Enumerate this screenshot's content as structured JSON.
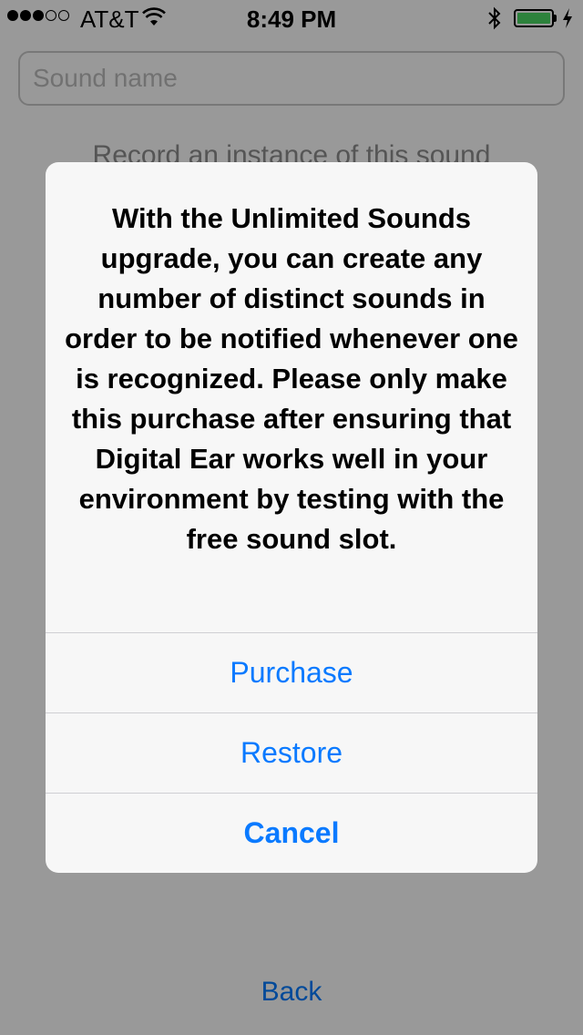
{
  "status_bar": {
    "carrier": "AT&T",
    "time": "8:49 PM",
    "signal_bars_filled": 3,
    "signal_bars_total": 5,
    "battery_color": "#4cd964"
  },
  "form": {
    "sound_name_placeholder": "Sound name",
    "instruction": "Record an instance of this sound",
    "back_label": "Back"
  },
  "alert": {
    "message": "With the Unlimited Sounds upgrade, you can create any number of distinct sounds in order to be notified whenever one is recognized. Please only make this purchase after ensuring that Digital Ear works well in your environment by testing with the free sound slot.",
    "buttons": {
      "purchase": "Purchase",
      "restore": "Restore",
      "cancel": "Cancel"
    }
  },
  "colors": {
    "accent": "#0a7aff"
  }
}
